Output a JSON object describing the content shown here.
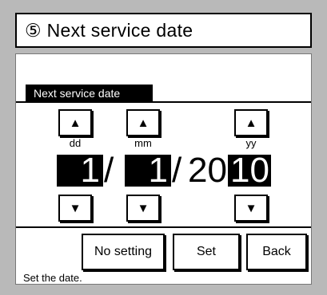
{
  "title": "⑤ Next service date",
  "section_label": "Next service date",
  "fields": {
    "day": {
      "label": "dd",
      "value": "1",
      "up_icon": "▲",
      "down_icon": "▼"
    },
    "month": {
      "label": "mm",
      "value": "1",
      "up_icon": "▲",
      "down_icon": "▼"
    },
    "year": {
      "label": "yy",
      "prefix": "20",
      "value": "10",
      "up_icon": "▲",
      "down_icon": "▼"
    }
  },
  "separator": "/",
  "buttons": {
    "no_setting": "No setting",
    "set": "Set",
    "back": "Back"
  },
  "status": "Set the date."
}
